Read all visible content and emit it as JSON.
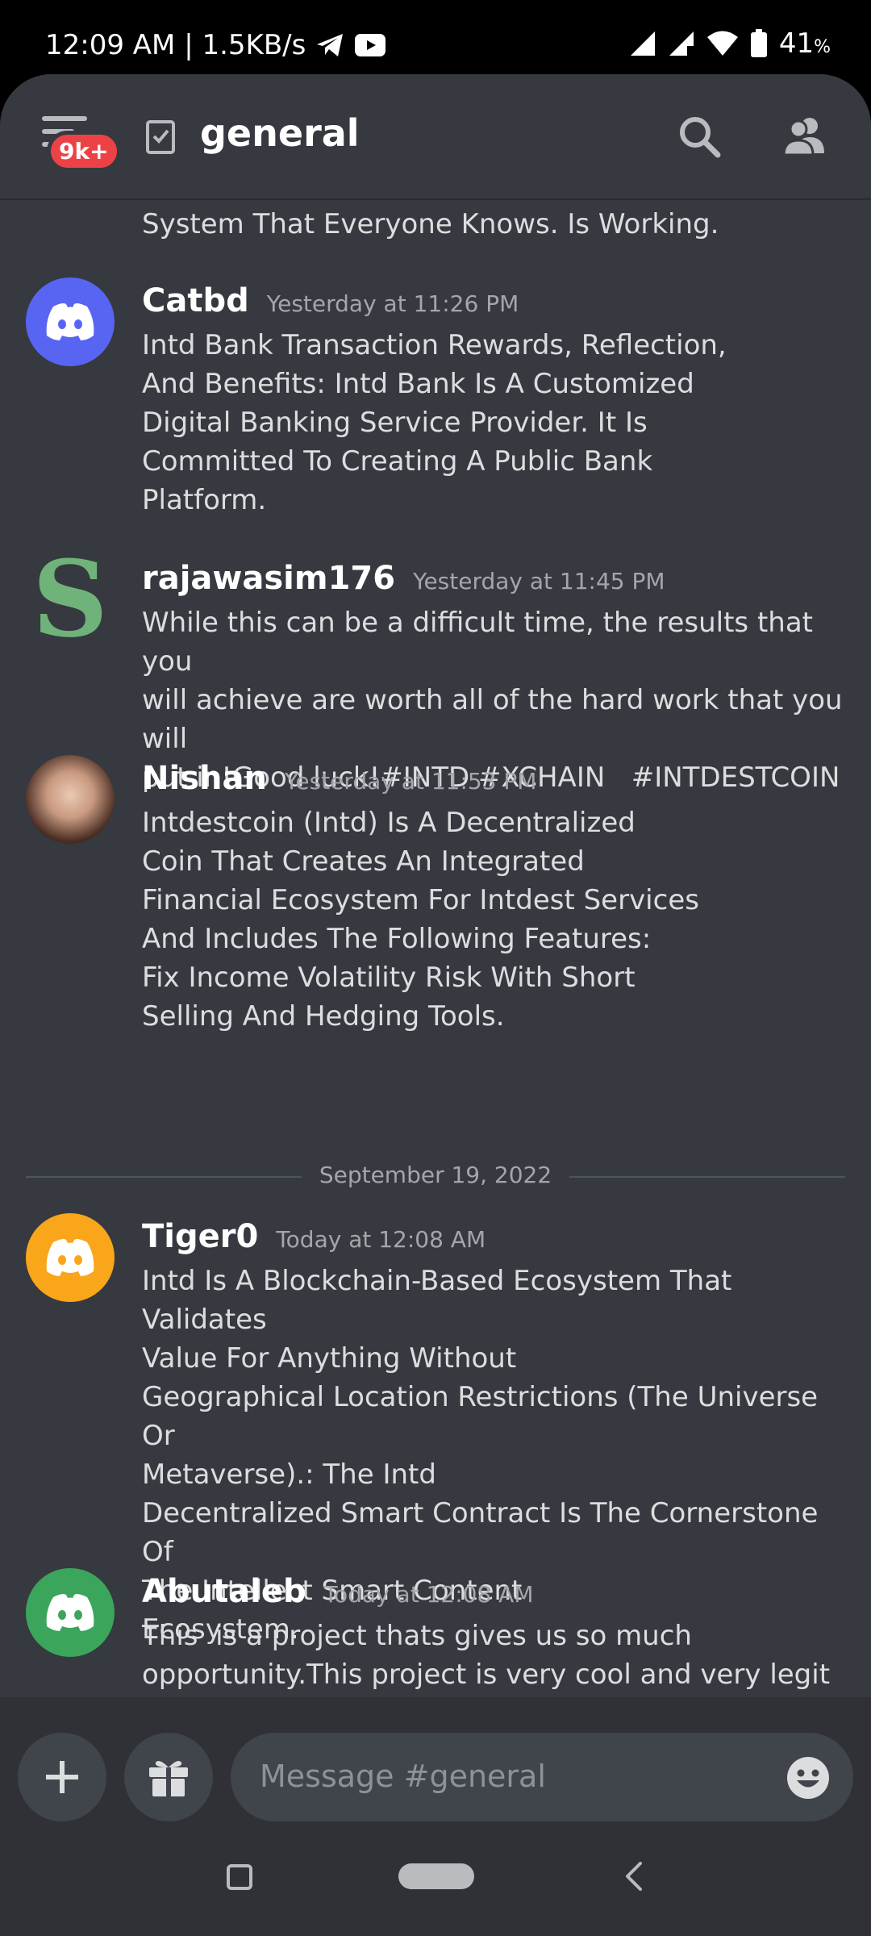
{
  "status_bar": {
    "time_speed": "12:09 AM | 1.5KB/s",
    "battery": "41",
    "battery_unit": "%"
  },
  "header": {
    "badge": "9k+",
    "channel_name": "general"
  },
  "messages": [
    {
      "partial_text": "System That Everyone Knows. Is Working."
    },
    {
      "author": "Catbd",
      "timestamp": "Yesterday at 11:26 PM",
      "avatar": "discord-logo",
      "avatar_color": "#5865f2",
      "text": "Intd Bank Transaction Rewards, Reflection,\nAnd Benefits: Intd Bank Is A Customized\nDigital Banking Service Provider. It Is\nCommitted To Creating A Public Bank\nPlatform."
    },
    {
      "author": "rajawasim176",
      "timestamp": "Yesterday at 11:45 PM",
      "avatar_letter": "S",
      "avatar_color": "#6fb27a",
      "text": "While this can be a difficult time, the results that you\nwill achieve are worth all of the hard work that you will\nput in!Good luck!#INTD #XCHAIN   #INTDESTCOIN"
    },
    {
      "author": "Nishan",
      "timestamp": "Yesterday at 11:53 PM",
      "avatar": "photo",
      "text": "Intdestcoin (Intd) Is A Decentralized\nCoin That Creates An Integrated\nFinancial Ecosystem For Intdest Services\nAnd Includes The Following Features:\nFix Income Volatility Risk With Short\nSelling And Hedging Tools."
    },
    {
      "author": "Tiger0",
      "timestamp": "Today at 12:08 AM",
      "avatar": "discord-logo",
      "avatar_color": "#faa61a",
      "text": "Intd Is A Blockchain-Based Ecosystem That Validates\nValue For Anything Without\nGeographical Location Restrictions (The Universe Or\nMetaverse).: The Intd\nDecentralized Smart Contract Is The Cornerstone Of\nThe Intellect Smart Content\nEcosystem."
    },
    {
      "author": "Abutaleb",
      "timestamp": "Today at 12:08 AM",
      "avatar": "discord-logo",
      "avatar_color": "#3ba55c",
      "text": "This  is a project thats gives us so much\nopportunity.This project is very cool and very legit\nproject.\n#INTD #XCHAIN  #INTDESTCOIN"
    }
  ],
  "date_divider": "September 19, 2022",
  "composer": {
    "placeholder": "Message #general"
  }
}
